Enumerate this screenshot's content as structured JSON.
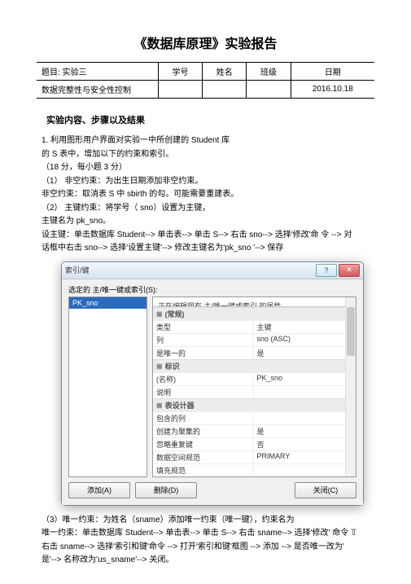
{
  "title": "《数据库原理》实验报告",
  "header": {
    "rows": [
      [
        "题目: 实验三",
        "学号",
        "姓名",
        "班级",
        "日期"
      ],
      [
        "数据完整性与安全性控制",
        "",
        "",
        "",
        "2016.10.18"
      ]
    ]
  },
  "section_header": "实验内容、步骤以及结果",
  "body_lines": [
    "1.                                                                 利用图形用户界面对实验一中所创建的       Student 库",
    "的 S 表中，增加以下的约束和索引。",
    "       （18 分，每小题 3 分）",
    "（1）  非空约束：为出生日期添加非空约束。",
    "        非空约束：取消表  S 中 sbirth 的勾。可能需要重建表。",
    "（2）                                                                    主键约束：将学号（ sno）设置为主键，",
    "主键名为                                                                           pk_sno。",
    "        设主键：单击数据库  Student--> 单击表--> 单击 S--> 右击 sno--> 选择'修改'命 令 --> 对",
    "        话框中右击 sno--> 选择'设置主键'--> 修改主键名为'pk_sno '--> 保存"
  ],
  "body_lines2": [
    "（3）唯一约束：为姓名（sname）添加唯一约束（唯一键），约束名为",
    "       唯一约束：单击数据库  Student--> 单击表--> 单击 S--> 右击 sname--> 选择'修改' 命令 𝕋",
    "       右击 sname--> 选择'索引和键'命令 --> 打开'索引和键'框图 --> 添加 --> 是否唯一改为'",
    "       是'--> 名称改为'us_sname'--> 关闭。"
  ],
  "dialog": {
    "title": "索引/键",
    "sel_label": "选定的 主/唯一键或索引(S):",
    "list_item": "PK_sno",
    "prop_info": "正在编辑现有 主/唯一键或索引 的属性。",
    "cat1": "(常规)",
    "rows1": [
      {
        "name": "类型",
        "val": "主键"
      },
      {
        "name": "列",
        "val": "sno (ASC)"
      },
      {
        "name": "是唯一的",
        "val": "是"
      }
    ],
    "cat2": "标识",
    "rows2": [
      {
        "name": "(名称)",
        "val": "PK_sno"
      },
      {
        "name": "说明",
        "val": ""
      }
    ],
    "cat3": "表设计器",
    "rows3": [
      {
        "name": "包含的列",
        "val": ""
      },
      {
        "name": "创建为聚集的",
        "val": "是"
      },
      {
        "name": "忽略重复键",
        "val": "否"
      },
      {
        "name": "数据空间规范",
        "val": "PRIMARY"
      },
      {
        "name": "填充规范",
        "val": ""
      }
    ],
    "btn_add": "添加(A)",
    "btn_del": "删除(D)",
    "btn_close": "关闭(C)"
  }
}
